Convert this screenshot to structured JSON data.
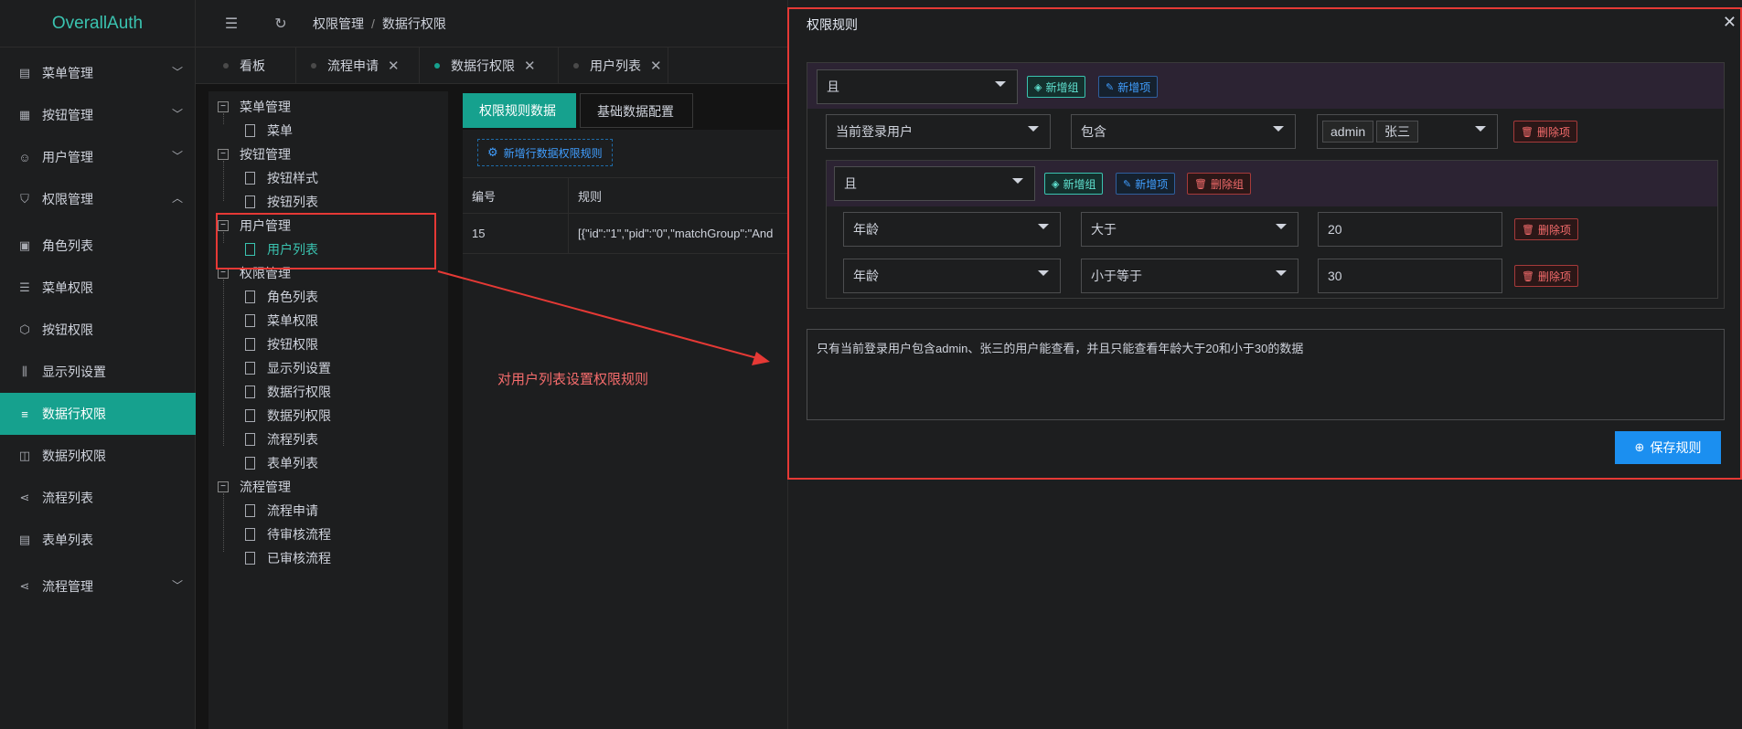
{
  "app": {
    "title": "OverallAuth"
  },
  "sidebar": {
    "items": [
      {
        "label": "菜单管理",
        "icon": "menu-icon"
      },
      {
        "label": "按钮管理",
        "icon": "button-icon"
      },
      {
        "label": "用户管理",
        "icon": "user-icon"
      },
      {
        "label": "权限管理",
        "icon": "shield-icon"
      },
      {
        "label": "角色列表",
        "icon": "role-icon"
      },
      {
        "label": "菜单权限",
        "icon": "list-icon"
      },
      {
        "label": "按钮权限",
        "icon": "cube-icon"
      },
      {
        "label": "显示列设置",
        "icon": "columns-icon"
      },
      {
        "label": "数据行权限",
        "icon": "sliders-icon"
      },
      {
        "label": "数据列权限",
        "icon": "col-perm-icon"
      },
      {
        "label": "流程列表",
        "icon": "share-icon"
      },
      {
        "label": "表单列表",
        "icon": "form-icon"
      },
      {
        "label": "流程管理",
        "icon": "share-icon"
      }
    ]
  },
  "header": {
    "breadcrumb": [
      "权限管理",
      "数据行权限"
    ]
  },
  "tabs": [
    {
      "label": "看板"
    },
    {
      "label": "流程申请"
    },
    {
      "label": "数据行权限"
    },
    {
      "label": "用户列表"
    }
  ],
  "tree": {
    "nodes": [
      {
        "label": "菜单管理"
      },
      {
        "label": "菜单"
      },
      {
        "label": "按钮管理"
      },
      {
        "label": "按钮样式"
      },
      {
        "label": "按钮列表"
      },
      {
        "label": "用户管理"
      },
      {
        "label": "用户列表"
      },
      {
        "label": "权限管理"
      },
      {
        "label": "角色列表"
      },
      {
        "label": "菜单权限"
      },
      {
        "label": "按钮权限"
      },
      {
        "label": "显示列设置"
      },
      {
        "label": "数据行权限"
      },
      {
        "label": "数据列权限"
      },
      {
        "label": "流程列表"
      },
      {
        "label": "表单列表"
      },
      {
        "label": "流程管理"
      },
      {
        "label": "流程申请"
      },
      {
        "label": "待审核流程"
      },
      {
        "label": "已审核流程"
      }
    ]
  },
  "content": {
    "subtabs": [
      "权限规则数据",
      "基础数据配置"
    ],
    "add_rule_label": "新增行数据权限规则",
    "grid": {
      "headers": [
        "编号",
        "规则"
      ],
      "rows": [
        {
          "id": "15",
          "rule": "[{\"id\":\"1\",\"pid\":\"0\",\"matchGroup\":\"And"
        }
      ]
    },
    "annotation": "对用户列表设置权限规则"
  },
  "dialog": {
    "title": "权限规则",
    "outer_group": {
      "logic": "且",
      "add_group_label": "新增组",
      "add_item_label": "新增项"
    },
    "row1": {
      "field": "当前登录用户",
      "operator": "包含",
      "tags": [
        "admin",
        "张三"
      ],
      "delete_label": "删除项"
    },
    "inner_group": {
      "logic": "且",
      "add_group_label": "新增组",
      "add_item_label": "新增项",
      "delete_group_label": "删除组",
      "rows": [
        {
          "field": "年龄",
          "operator": "大于",
          "value": "20",
          "delete_label": "删除项"
        },
        {
          "field": "年龄",
          "operator": "小于等于",
          "value": "30",
          "delete_label": "删除项"
        }
      ]
    },
    "description": "只有当前登录用户包含admin、张三的用户能查看，并且只能查看年龄大于20和小于30的数据",
    "save_label": "保存规则"
  },
  "colors": {
    "accent": "#16a18e",
    "primary": "#1b8ff0",
    "danger": "#e53935"
  }
}
